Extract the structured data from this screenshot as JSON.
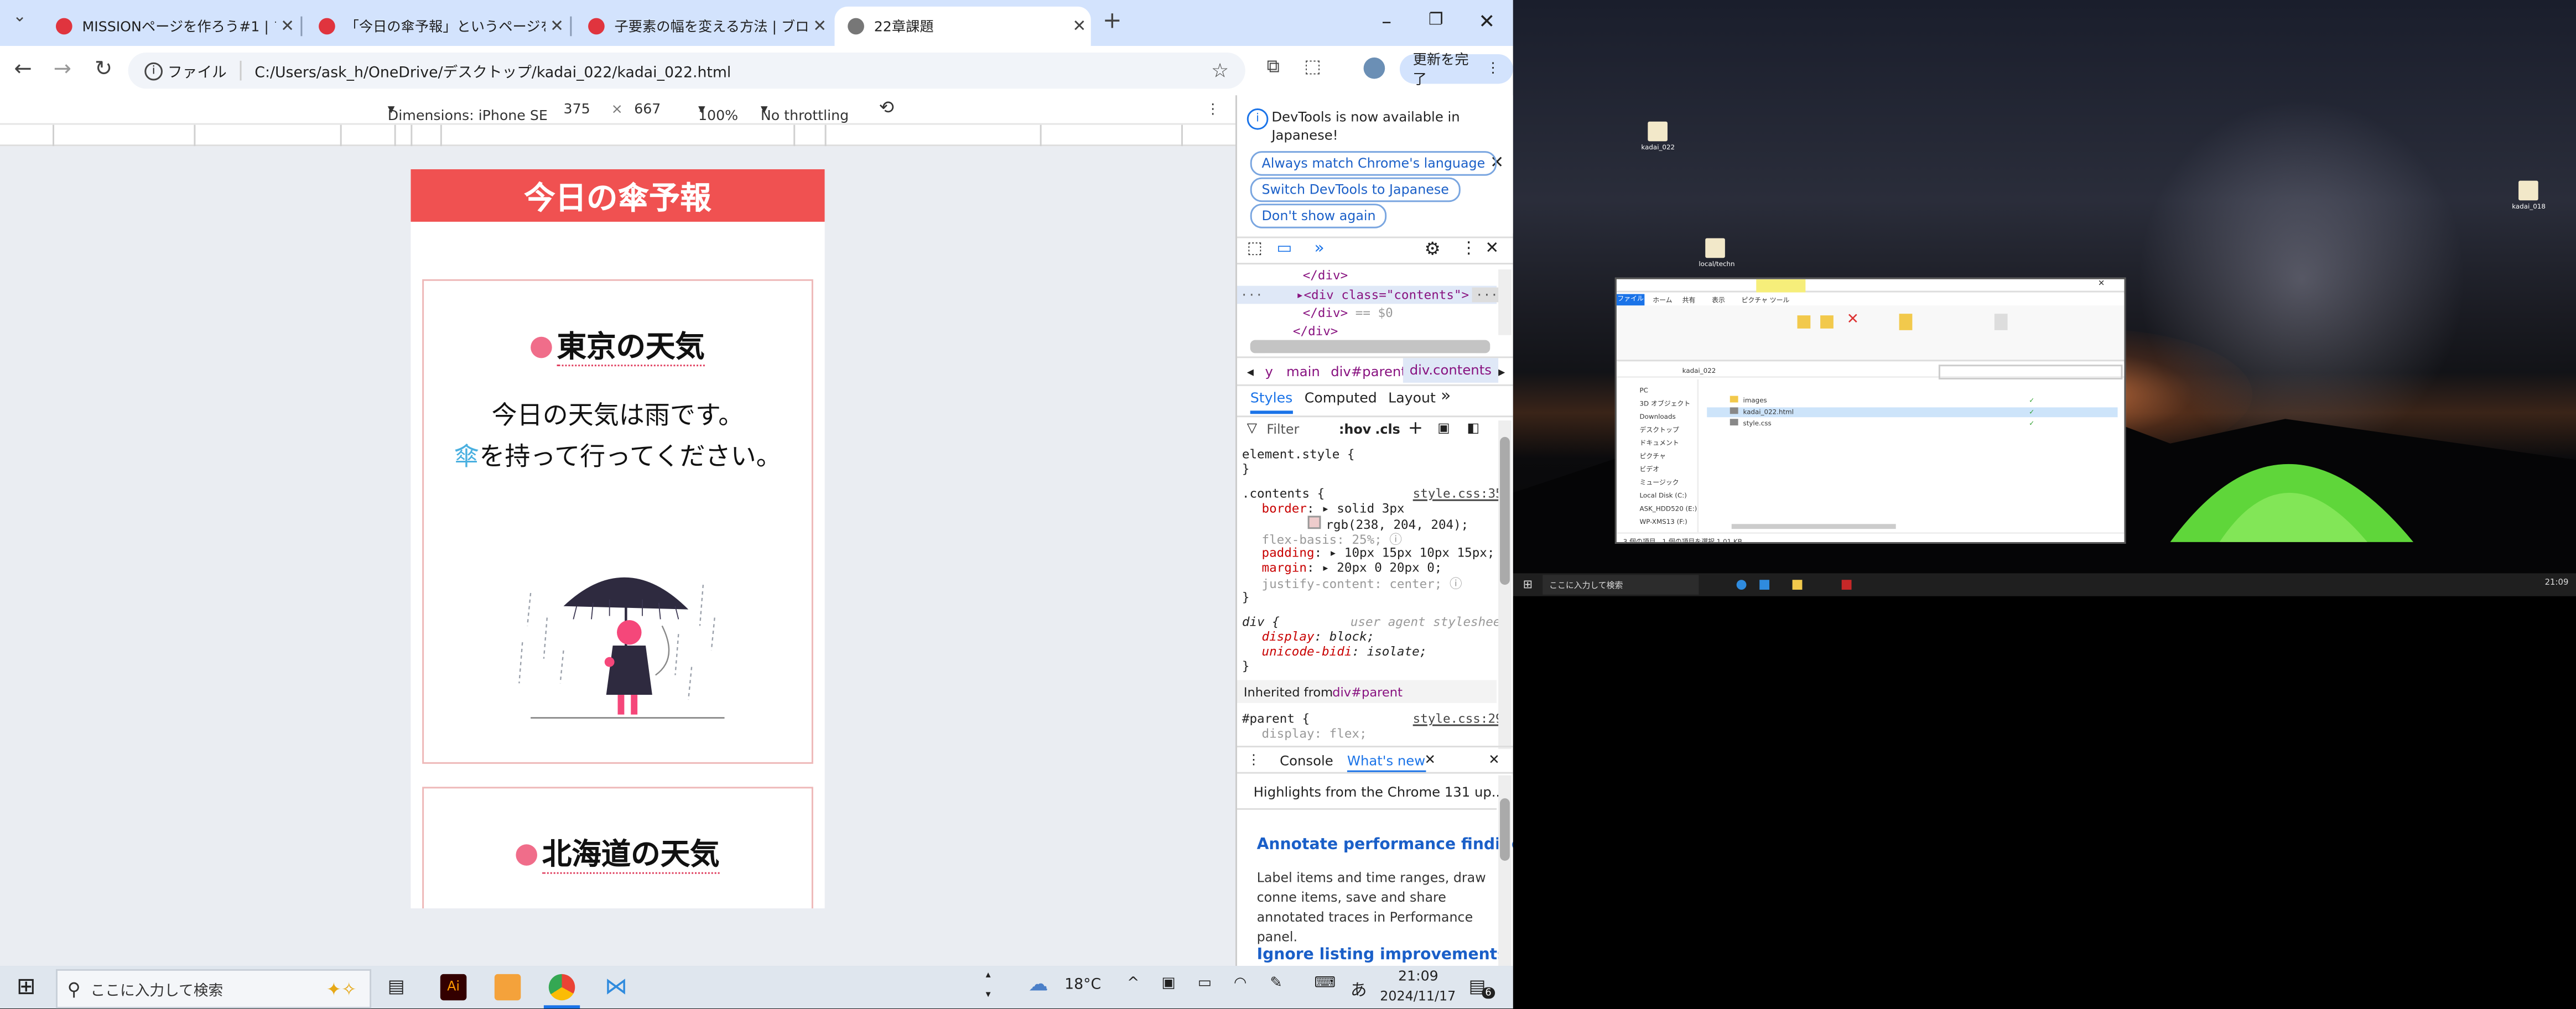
{
  "browser": {
    "tabs": [
      {
        "title": "MISSIONページを作ろう#1 | ブログ"
      },
      {
        "title": "「今日の傘予報」というページを作成"
      },
      {
        "title": "子要素の幅を変える方法 | ブログ"
      },
      {
        "title": "22章課題"
      }
    ],
    "url_label": "ファイル",
    "url": "C:/Users/ask_h/OneDrive/デスクトップ/kadai_022/kadai_022.html",
    "update_button": "更新を完了"
  },
  "device_toolbar": {
    "dimensions": "Dimensions: iPhone SE",
    "width": "375",
    "times": "×",
    "height": "667",
    "zoom": "100%",
    "throttling": "No throttling"
  },
  "page": {
    "header": "今日の傘予報",
    "cards": [
      {
        "title": "東京の天気",
        "forecast": "今日の天気は雨です。",
        "umbrella_char": "傘",
        "forecast_rest": "を持って行ってください。"
      },
      {
        "title": "北海道の天気"
      }
    ]
  },
  "devtools": {
    "banner_text": "DevTools is now available in Japanese!",
    "banner_buttons": [
      "Always match Chrome's language",
      "Switch DevTools to Japanese",
      "Don't show again"
    ],
    "dom": {
      "line1": "</div>",
      "line2_open": "<div class=\"contents\">",
      "line2_eq": "== $0",
      "line3": "</div>",
      "line4": "</div>"
    },
    "breadcrumbs": [
      "y",
      "main",
      "div#parent",
      "div.contents"
    ],
    "style_tabs": [
      "Styles",
      "Computed",
      "Layout"
    ],
    "filter_placeholder": "Filter",
    "hov": ":hov",
    "cls": ".cls",
    "element_style": "element.style {",
    "close_brace": "}",
    "contents_rule": {
      "selector": ".contents {",
      "source": "style.css:35",
      "decls": [
        {
          "prop": "border",
          "val": "▸ solid 3px"
        },
        {
          "prop": "",
          "val": "rgb(238, 204, 204);"
        },
        {
          "prop": "flex-basis",
          "val": "25%;"
        },
        {
          "prop": "padding",
          "val": "▸ 10px 15px 10px 15px;"
        },
        {
          "prop": "margin",
          "val": "▸ 20px 0 20px 0;"
        },
        {
          "prop": "justify-content",
          "val": "center;"
        }
      ]
    },
    "div_rule": {
      "selector": "div {",
      "source": "user agent stylesheet",
      "decls": [
        {
          "prop": "display",
          "val": "block;"
        },
        {
          "prop": "unicode-bidi",
          "val": "isolate;"
        }
      ]
    },
    "inherited_label": "Inherited from",
    "inherited_from": "div#parent",
    "parent_rule": {
      "selector": "#parent {",
      "source": "style.css:29",
      "first_decl": "display: flex;"
    },
    "drawer_tabs": [
      "Console",
      "What's new"
    ],
    "whatsnew": {
      "highlights": "Highlights from the Chrome 131 up...",
      "heading1": "Annotate performance findings",
      "body1": "Label items and time ranges, draw conne items, save and share annotated traces in Performance panel.",
      "heading2": "Ignore listing improvements"
    }
  },
  "desktop": {
    "icons": [
      "kadai_022",
      "kadai_018",
      "local/techn"
    ],
    "explorer": {
      "ribbon_tabs": [
        "ファイル",
        "ホーム",
        "共有",
        "表示",
        "ピクチャ ツール"
      ],
      "path": "kadai_022",
      "files": [
        {
          "name": "images"
        },
        {
          "name": "kadai_022.html"
        },
        {
          "name": "style.css"
        }
      ],
      "sidebar": [
        "PC",
        "3D オブジェクト",
        "Downloads",
        "デスクトップ",
        "ドキュメント",
        "ピクチャ",
        "ビデオ",
        "ミュージック",
        "Local Disk (C:)",
        "ASK_HDD520 (E:)",
        "WP-XMS13 (F:)"
      ],
      "status": "3 個の項目　1 個の項目を選択 1.01 KB"
    },
    "taskbar_search": "ここに入力して検索",
    "clock": "21:09"
  },
  "taskbar": {
    "search_placeholder": "ここに入力して検索",
    "temperature": "18°C",
    "ime": "あ",
    "time": "21:09",
    "date": "2024/11/17",
    "notifications": "6"
  },
  "colors": {
    "page_header": "#f05151",
    "card_border": "#eeb8b8",
    "accent_dot": "#f06d8a",
    "umbrella_text": "#4ab0e0",
    "tab_bar": "#d3e3fd"
  }
}
